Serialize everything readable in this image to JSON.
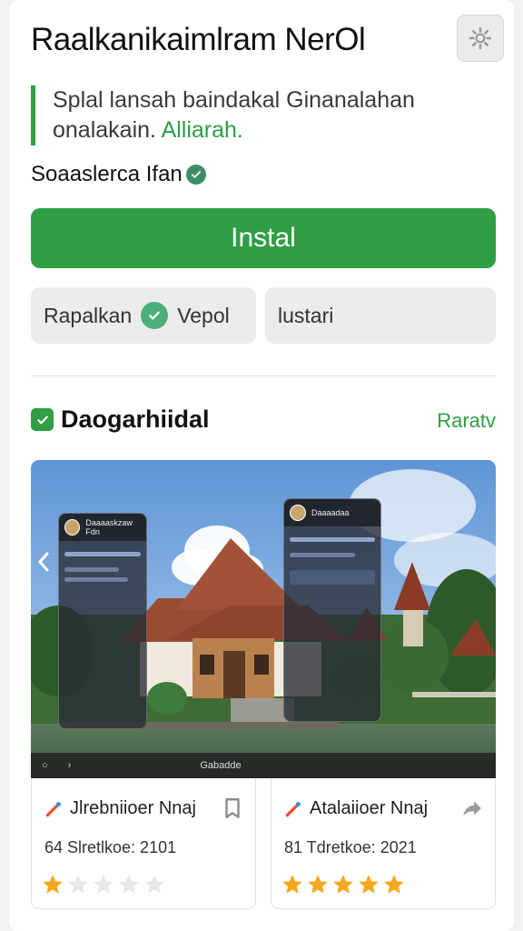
{
  "header": {
    "app_title": "Raalkanikaimlram NerOl",
    "settings_icon": "gear-icon"
  },
  "description": {
    "text": "Splal lansah baindakal Ginanalahan onalakain.",
    "accent": "Alliarah."
  },
  "developer": {
    "name": "Soaaslerca Ifan",
    "verified_icon": "check-circle-icon"
  },
  "actions": {
    "install_label": "Instal",
    "secondary_left_label_a": "Rapalkan",
    "secondary_left_label_b": "Vepol",
    "secondary_right_label": "lustari"
  },
  "section": {
    "title": "Daogarhiidal",
    "link": "Raratv"
  },
  "screenshot": {
    "panel_left_title": "Daaaaskzaw Fdn",
    "panel_right_title": "Daaaadaa",
    "bottom_bar_label": "Gabadde"
  },
  "cards": [
    {
      "title": "Jlrebniioer Nnaj",
      "meta": "64 Slretlkoe: 2101",
      "rating_filled": 1,
      "rating_total": 5
    },
    {
      "title": "Atalaiioer Nnaj",
      "meta": "81 Tdretkoe: 2021",
      "rating_filled": 5,
      "rating_total": 5
    }
  ],
  "colors": {
    "accent": "#2f9e44",
    "star": "#f4a81d",
    "star_empty": "#e8e8e8"
  }
}
